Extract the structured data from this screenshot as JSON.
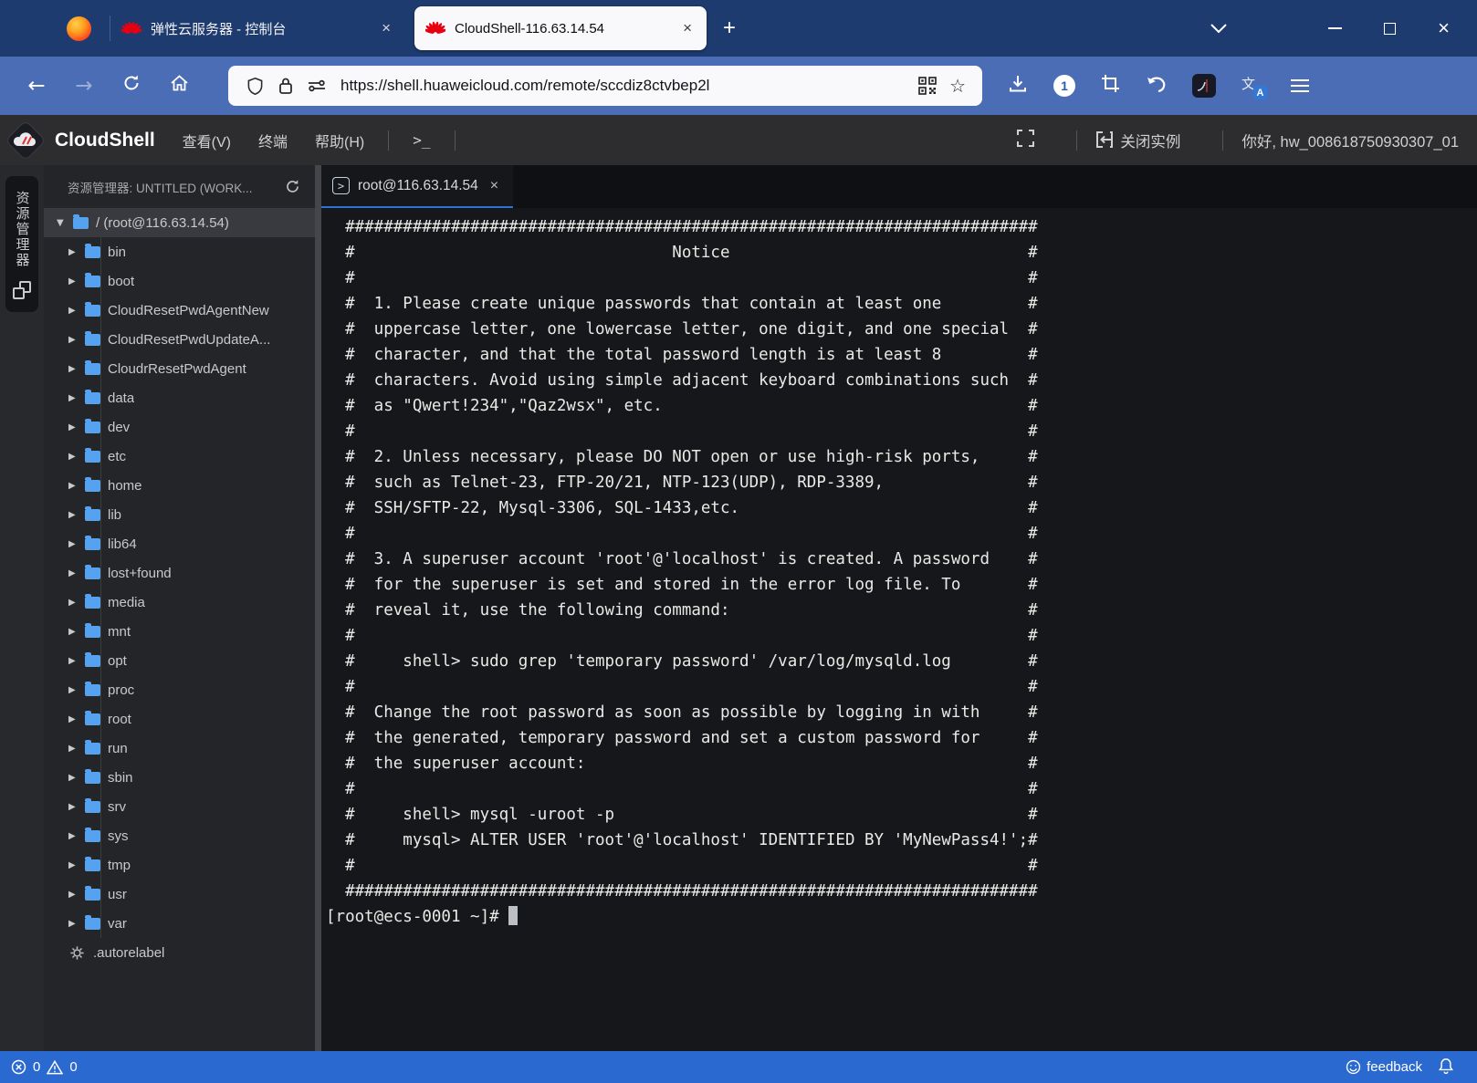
{
  "colors": {
    "accent_blue": "#2a6ad0",
    "huawei_red": "#e60012",
    "tab_underline": "#2e72d8",
    "folder_blue": "#55a3f0",
    "titlebar_navy": "#1d3b6e",
    "toolbar_blue": "#4b6db5"
  },
  "browser": {
    "tabs": [
      {
        "title": "弹性云服务器 - 控制台"
      },
      {
        "title": "CloudShell-116.63.14.54"
      }
    ],
    "url": "https://shell.huaweicloud.com/remote/sccdiz8ctvbep2l",
    "extension_badge": "1"
  },
  "icons": {
    "close": "×",
    "new_tab": "+",
    "back": "←",
    "forward": "→",
    "star": "☆",
    "tree_expanded": "▼",
    "tree_collapsed": "▶",
    "menu_terminal_glyph": ">_",
    "terminal_tab_glyph": ">",
    "translate_zh": "文",
    "translate_en": "A"
  },
  "app_header": {
    "logo": "CloudShell",
    "menus": [
      "查看(V)",
      "终端",
      "帮助(H)"
    ],
    "close_instance": "关闭实例",
    "greeting": "你好, hw_008618750930307_01"
  },
  "sidebar": {
    "activity_tab": "资源管理器",
    "header": "资源管理器: UNTITLED (WORK...",
    "root_label": "/ (root@116.63.14.54)",
    "folders": [
      "bin",
      "boot",
      "CloudResetPwdAgentNew",
      "CloudResetPwdUpdateA...",
      "CloudrResetPwdAgent",
      "data",
      "dev",
      "etc",
      "home",
      "lib",
      "lib64",
      "lost+found",
      "media",
      "mnt",
      "opt",
      "proc",
      "root",
      "run",
      "sbin",
      "srv",
      "sys",
      "tmp",
      "usr",
      "var"
    ],
    "special_file": ".autorelabel"
  },
  "terminal": {
    "tab_title": "root@116.63.14.54",
    "banner_lines": [
      "  ########################################################################",
      "  #                                 Notice                               #",
      "  #                                                                      #",
      "  #  1. Please create unique passwords that contain at least one         #",
      "  #  uppercase letter, one lowercase letter, one digit, and one special  #",
      "  #  character, and that the total password length is at least 8         #",
      "  #  characters. Avoid using simple adjacent keyboard combinations such  #",
      "  #  as \"Qwert!234\",\"Qaz2wsx\", etc.                                      #",
      "  #                                                                      #",
      "  #  2. Unless necessary, please DO NOT open or use high-risk ports,     #",
      "  #  such as Telnet-23, FTP-20/21, NTP-123(UDP), RDP-3389,               #",
      "  #  SSH/SFTP-22, Mysql-3306, SQL-1433,etc.                              #",
      "  #                                                                      #",
      "  #  3. A superuser account 'root'@'localhost' is created. A password    #",
      "  #  for the superuser is set and stored in the error log file. To       #",
      "  #  reveal it, use the following command:                               #",
      "  #                                                                      #",
      "  #     shell> sudo grep 'temporary password' /var/log/mysqld.log        #",
      "  #                                                                      #",
      "  #  Change the root password as soon as possible by logging in with     #",
      "  #  the generated, temporary password and set a custom password for     #",
      "  #  the superuser account:                                              #",
      "  #                                                                      #",
      "  #     shell> mysql -uroot -p                                           #",
      "  #     mysql> ALTER USER 'root'@'localhost' IDENTIFIED BY 'MyNewPass4!';#",
      "  #                                                                      #",
      "  ########################################################################"
    ],
    "prompt": "[root@ecs-0001 ~]# "
  },
  "status_bar": {
    "error_count": "0",
    "warning_count": "0",
    "feedback_label": "feedback"
  }
}
